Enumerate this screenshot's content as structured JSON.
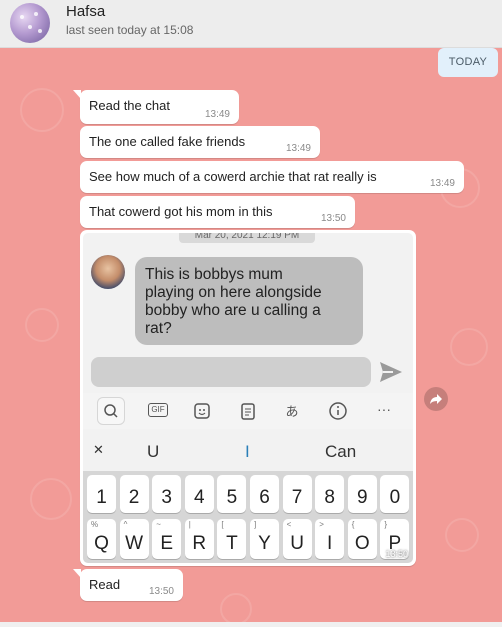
{
  "header": {
    "contact_name": "Hafsa",
    "last_seen": "last seen today at 15:08",
    "avatar_icon": "profile-avatar"
  },
  "date_separator": "TODAY",
  "messages": [
    {
      "text": "Read the chat",
      "time": "13:49"
    },
    {
      "text": "The one called fake friends",
      "time": "13:49"
    },
    {
      "text": "See how much of a cowerd archie that rat really is",
      "time": "13:49"
    },
    {
      "text": "That cowerd got his mom in this",
      "time": "13:50"
    },
    {
      "text": "Read",
      "time": "13:50"
    }
  ],
  "image_message": {
    "time": "13:50",
    "screenshot": {
      "date_chip": "Mar 20, 2021 12:19 PM",
      "message": "This is bobbys mum\nplaying on here alongside\nbobby who are u calling a\nrat?",
      "toolbar_icons": [
        "search-icon",
        "gif-icon",
        "sticker-icon",
        "clipboard-icon",
        "translate-icon",
        "info-icon",
        "more-icon"
      ],
      "gif_label": "GIF",
      "more_label": "···",
      "suggestions": {
        "collapse": "✕",
        "left": "U",
        "middle": "I",
        "right": "Can"
      },
      "number_row": [
        "1",
        "2",
        "3",
        "4",
        "5",
        "6",
        "7",
        "8",
        "9",
        "0"
      ],
      "letter_row": [
        {
          "key": "Q",
          "sup": "%"
        },
        {
          "key": "W",
          "sup": "^"
        },
        {
          "key": "E",
          "sup": "~"
        },
        {
          "key": "R",
          "sup": "|"
        },
        {
          "key": "T",
          "sup": "["
        },
        {
          "key": "Y",
          "sup": "]"
        },
        {
          "key": "U",
          "sup": "<"
        },
        {
          "key": "I",
          "sup": ">"
        },
        {
          "key": "O",
          "sup": "{"
        },
        {
          "key": "P",
          "sup": "}"
        }
      ]
    }
  },
  "colors": {
    "chat_background": "#f29b97",
    "bubble": "#ffffff",
    "header": "#ededed",
    "today_chip": "#e2f0fb"
  }
}
